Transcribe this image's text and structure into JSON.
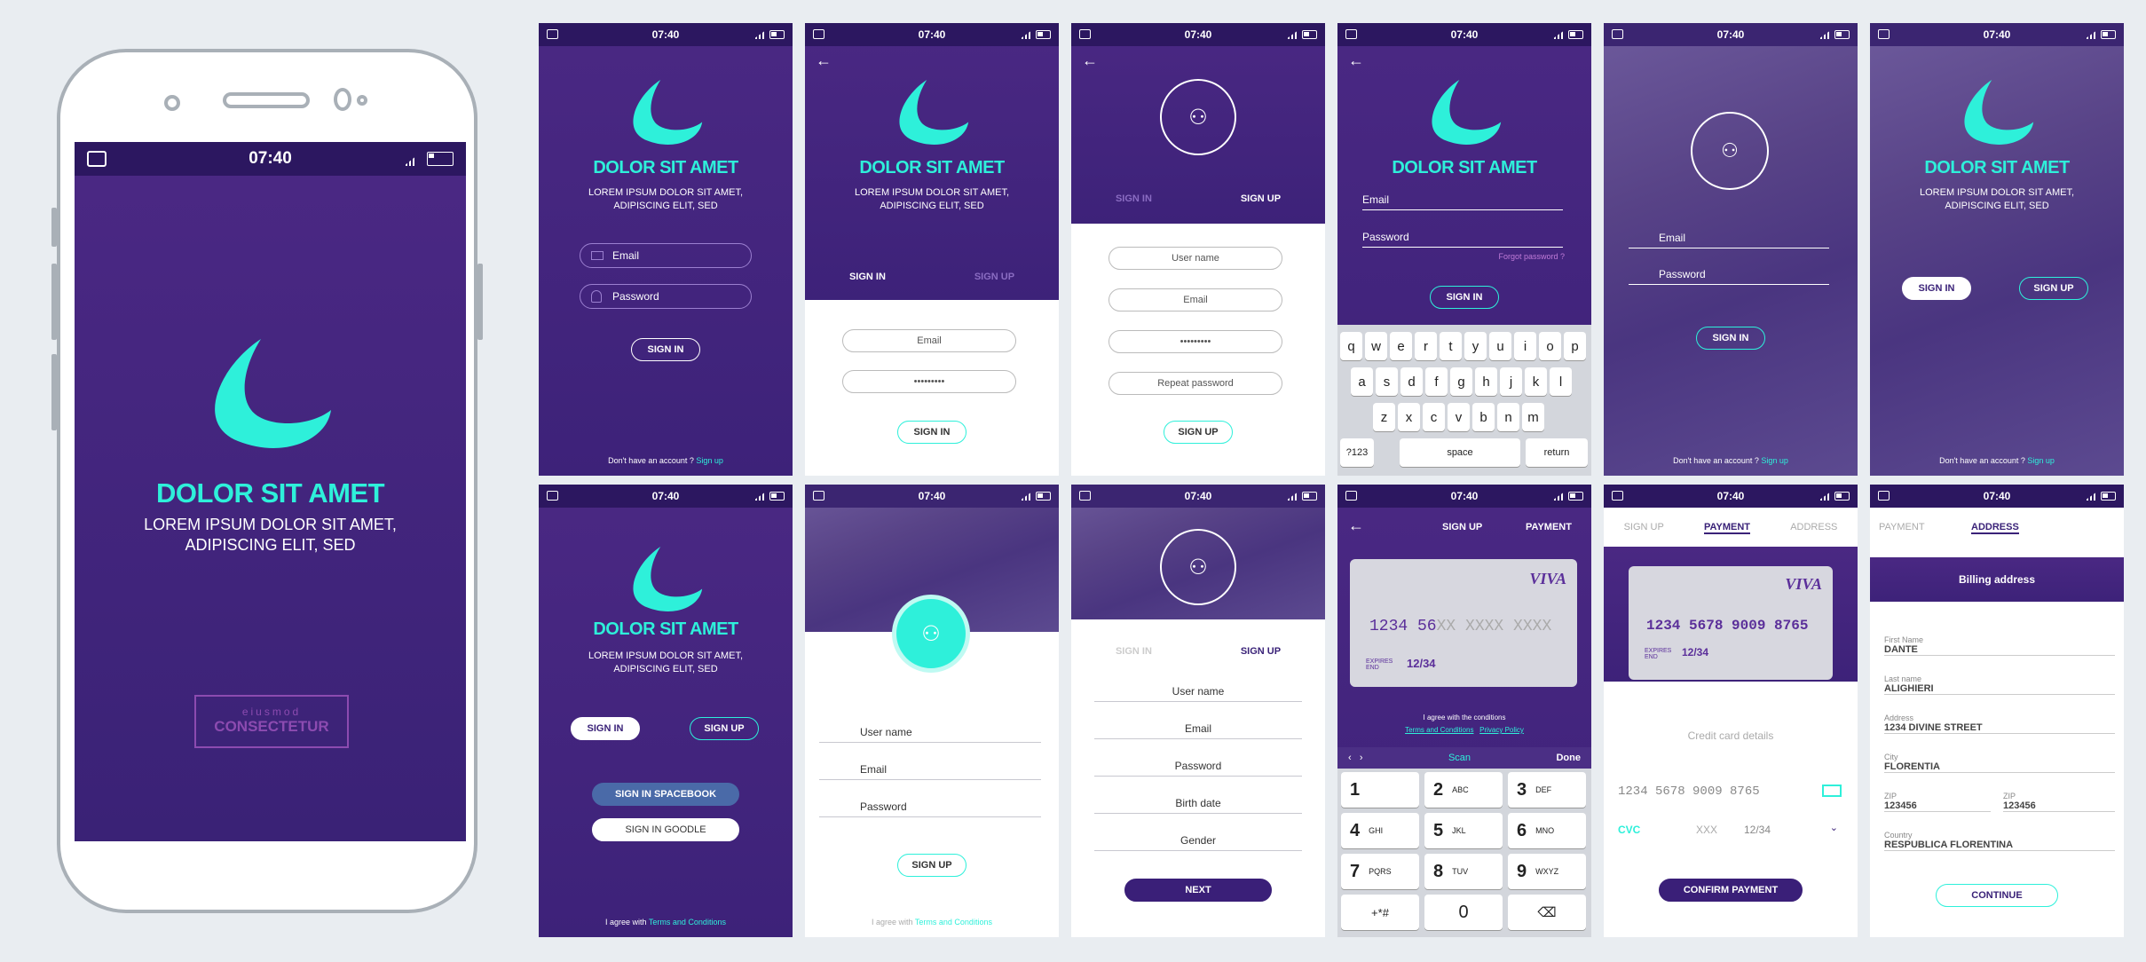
{
  "time": "07:40",
  "brand": "DOLOR SIT AMET",
  "tagline1": "LOREM IPSUM DOLOR SIT AMET,",
  "tagline2": "ADIPISCING ELIT, SED",
  "logo_small": "eiusmod",
  "logo_big": "CONSECTETUR",
  "email": "Email",
  "password": "Password",
  "sign_in": "SIGN IN",
  "sign_up": "SIGN UP",
  "dont_have": "Don't have an account ?",
  "sign_up_link": "Sign up",
  "forgot": "Forgot password ?",
  "masked": "•••••••••",
  "user_name": "User name",
  "repeat_password": "Repeat password",
  "birth_date": "Birth date",
  "gender": "Gender",
  "next": "NEXT",
  "sign_in_facebook": "SIGN IN SPACEBOOK",
  "sign_in_google": "SIGN IN GOODLE",
  "agree_prefix": "I agree with",
  "terms": "Terms and Conditions",
  "agree_conditions": "I agree with the conditions",
  "privacy": "Privacy Policy",
  "payment": "PAYMENT",
  "address": "ADDRESS",
  "card_brand": "VIVA",
  "card_partial": "1234 56",
  "card_rest": "XX XXXX XXXX",
  "card_full": "1234 5678 9009 8765",
  "expires": "EXPIRES END",
  "expiry": "12/34",
  "scan": "Scan",
  "done": "Done",
  "credit_details": "Credit card details",
  "cvc": "CVC",
  "cvc_ph": "XXX",
  "confirm": "CONFIRM PAYMENT",
  "billing": "Billing address",
  "continue": "CONTINUE",
  "keyboard": {
    "row1": [
      "q",
      "w",
      "e",
      "r",
      "t",
      "y",
      "u",
      "i",
      "o",
      "p"
    ],
    "row2": [
      "a",
      "s",
      "d",
      "f",
      "g",
      "h",
      "j",
      "k",
      "l"
    ],
    "row3": [
      "z",
      "x",
      "c",
      "v",
      "b",
      "n",
      "m"
    ],
    "num": "?123",
    "space": "space",
    "ret": "return"
  },
  "keypad": [
    [
      "1",
      ""
    ],
    [
      "2",
      "ABC"
    ],
    [
      "3",
      "DEF"
    ],
    [
      "4",
      "GHI"
    ],
    [
      "5",
      "JKL"
    ],
    [
      "6",
      "MNO"
    ],
    [
      "7",
      "PQRS"
    ],
    [
      "8",
      "TUV"
    ],
    [
      "9",
      "WXYZ"
    ]
  ],
  "keypad_extra": [
    "+*#",
    "0"
  ],
  "billing_fields": [
    {
      "label": "First Name",
      "value": "DANTE"
    },
    {
      "label": "Last name",
      "value": "ALIGHIERI"
    },
    {
      "label": "Address",
      "value": "1234 DIVINE STREET"
    },
    {
      "label": "City",
      "value": "FLORENTIA"
    },
    {
      "label": "ZIP",
      "value": "123456"
    },
    {
      "label": "ZIP",
      "value": "123456"
    },
    {
      "label": "Country",
      "value": "RESPUBLICA FLORENTINA"
    }
  ]
}
